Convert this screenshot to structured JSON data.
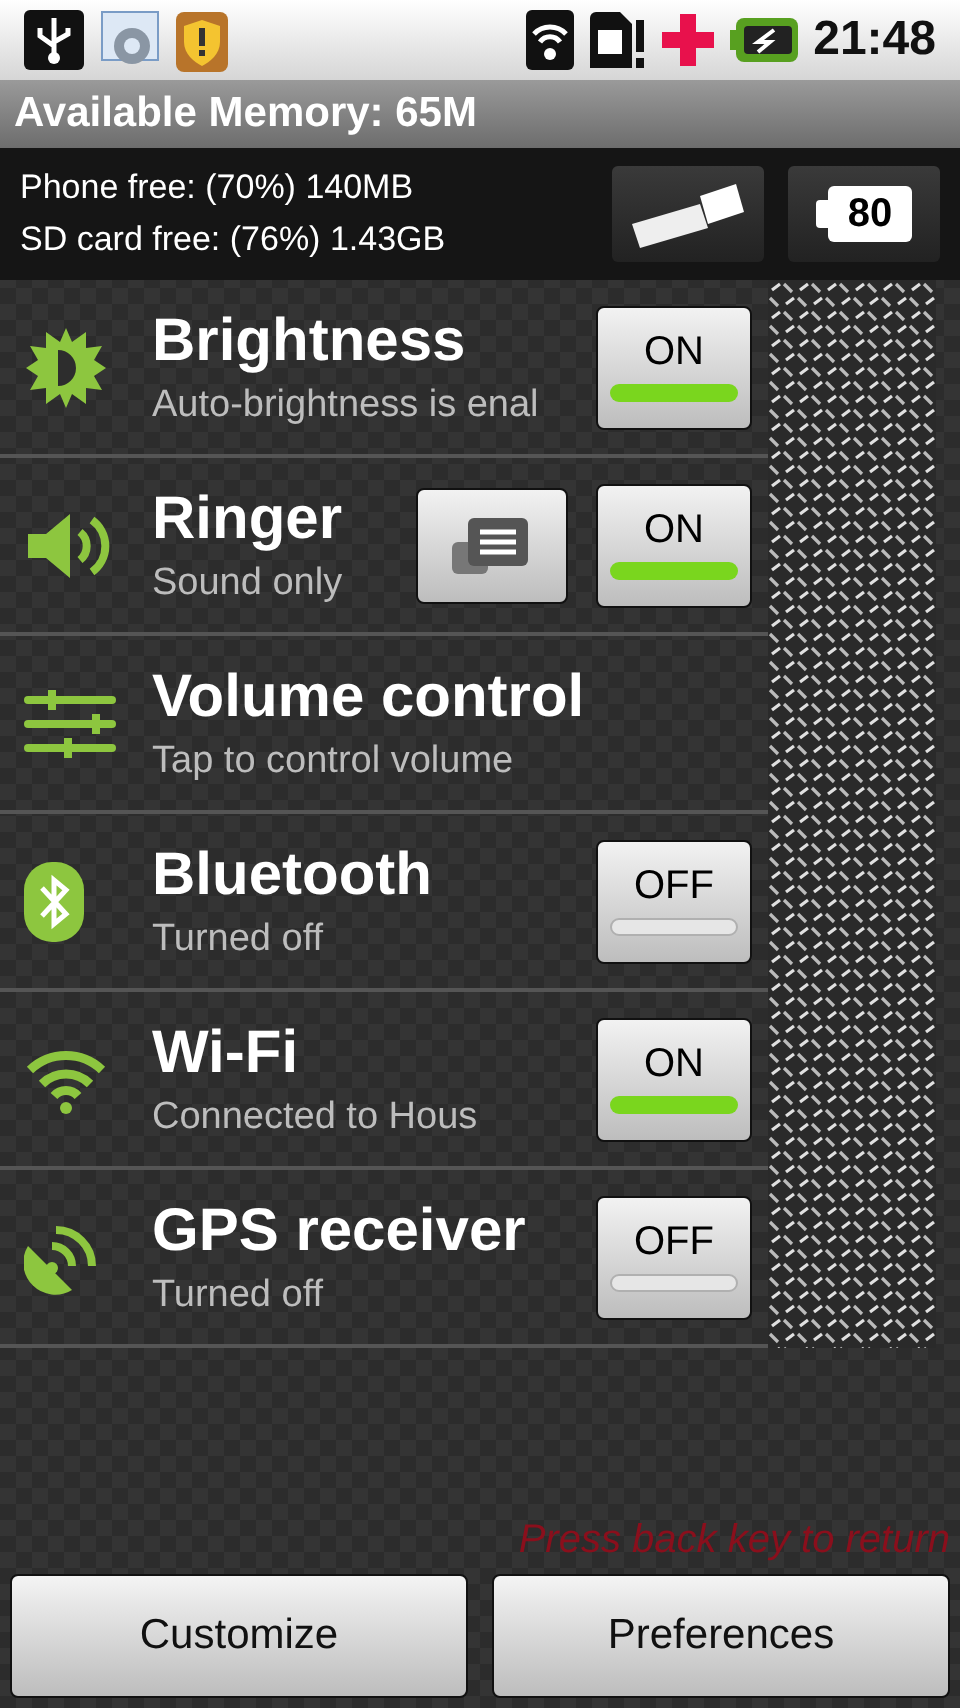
{
  "status_bar": {
    "time": "21:48"
  },
  "header": {
    "title": "Available Memory: 65M"
  },
  "storage": {
    "lines": [
      "Phone free: (70%) 140MB",
      "SD card free: (76%) 1.43GB"
    ],
    "battery_level": "80"
  },
  "rows": [
    {
      "kind": "toggle",
      "title": "Brightness",
      "subtitle": "Auto-brightness is enal",
      "toggle_label": "ON",
      "on": true
    },
    {
      "kind": "mode_toggle",
      "title": "Ringer",
      "subtitle": "Sound only",
      "toggle_label": "ON",
      "on": true
    },
    {
      "kind": "link",
      "title": "Volume control",
      "subtitle": "Tap to control volume"
    },
    {
      "kind": "toggle",
      "title": "Bluetooth",
      "subtitle": "Turned off",
      "toggle_label": "OFF",
      "on": false
    },
    {
      "kind": "toggle",
      "title": "Wi-Fi",
      "subtitle": "Connected to Hous",
      "toggle_label": "ON",
      "on": true
    },
    {
      "kind": "toggle",
      "title": "GPS receiver",
      "subtitle": "Turned off",
      "toggle_label": "OFF",
      "on": false
    }
  ],
  "hint": "Press back key to return",
  "buttons": [
    "Customize",
    "Preferences"
  ]
}
